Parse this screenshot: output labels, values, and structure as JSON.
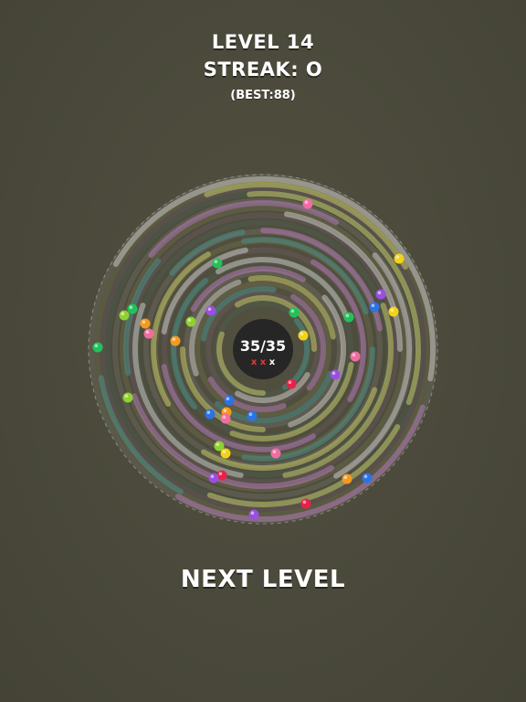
{
  "hud": {
    "level": "LEVEL 14",
    "streak": "STREAK: O",
    "best": "(BEST:88)"
  },
  "hub": {
    "score": "35/35",
    "misses": "x x x",
    "used_misses": 2
  },
  "next_level_label": "NEXT LEVEL",
  "colors": {
    "background": "#4a493b",
    "hub": "#262626",
    "ring_white": "#c9c6c2",
    "ring_yellow": "#c5c66a",
    "ring_purple": "#b07ab5",
    "ring_teal": "#4d8e86",
    "miss_used": "#e53935",
    "miss_free": "#ffffff",
    "ball_green": "#22c25a",
    "ball_lime": "#8fd22f",
    "ball_yellow": "#f2d21a",
    "ball_orange": "#f59a1e",
    "ball_pink": "#f06da0",
    "ball_red": "#e8214a",
    "ball_blue": "#2b73e6",
    "ball_purple": "#9a4fe0"
  }
}
